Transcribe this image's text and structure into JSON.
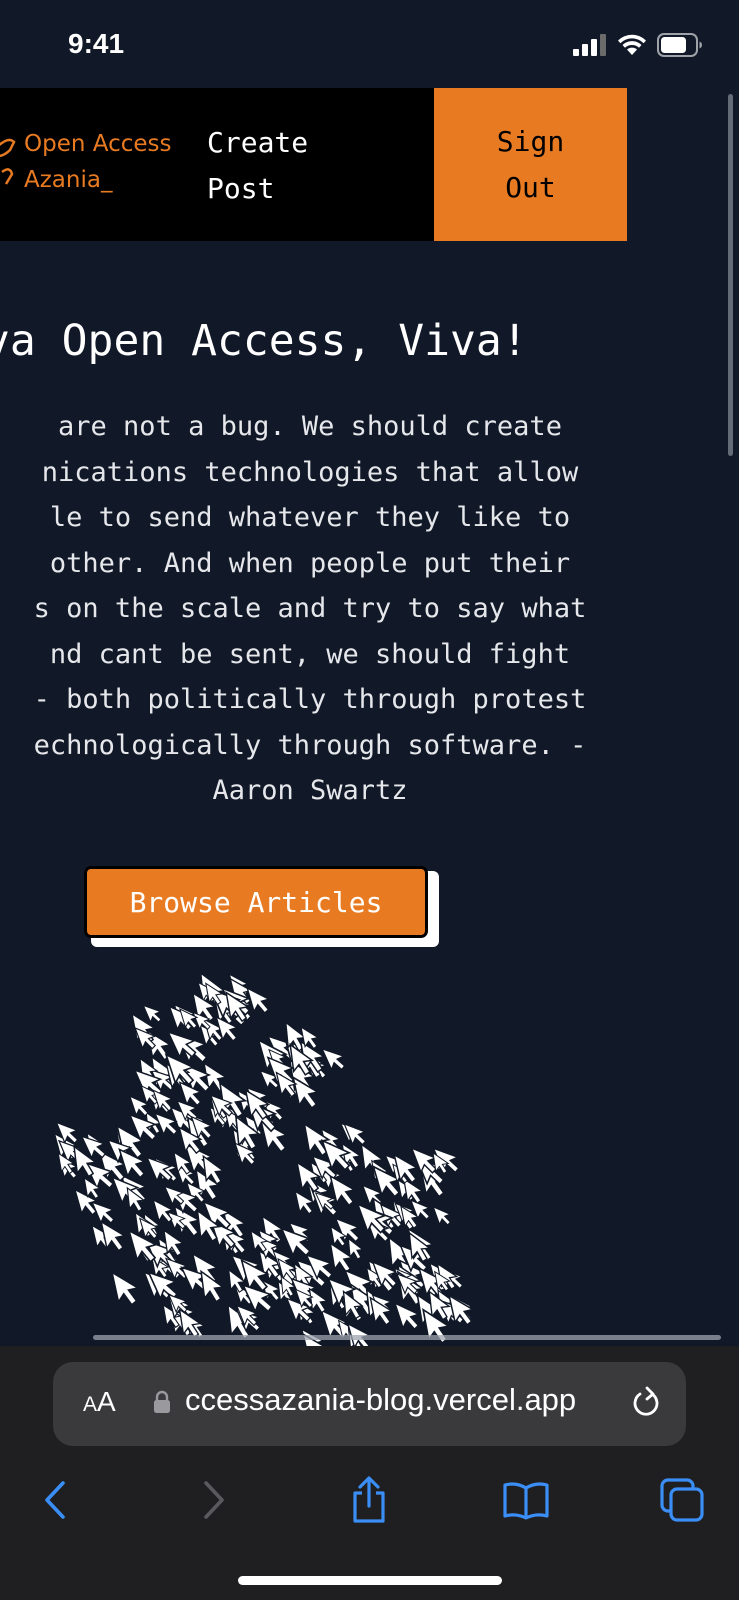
{
  "status_bar": {
    "time": "9:41"
  },
  "navbar": {
    "logo_line1": "Open Access",
    "logo_line2": "Azania_",
    "create_line1": "Create",
    "create_line2": "Post",
    "signout_line1": "Sign",
    "signout_line2": "Out"
  },
  "hero": {
    "title": "va Open Access, Viva!",
    "quote_lines": [
      "are not a bug. We should create",
      "nications technologies that allow",
      "le to send whatever they like to",
      "other. And when people put their",
      "s on the scale and try to say what",
      "nd cant be sent, we should fight",
      "- both politically through protest",
      "echnologically through software. -",
      "Aaron Swartz"
    ],
    "browse_button": "Browse Articles"
  },
  "browser": {
    "aa_small": "A",
    "aa_large": "A",
    "url": "ccessazania-blog.vercel.app"
  },
  "colors": {
    "accent": "#e87b22",
    "background": "#111827",
    "navbar": "#000000"
  },
  "icons": [
    "signal-icon",
    "wifi-icon",
    "battery-icon",
    "lock-icon",
    "reload-icon",
    "back-icon",
    "forward-icon",
    "share-icon",
    "bookmarks-icon",
    "tabs-icon"
  ]
}
